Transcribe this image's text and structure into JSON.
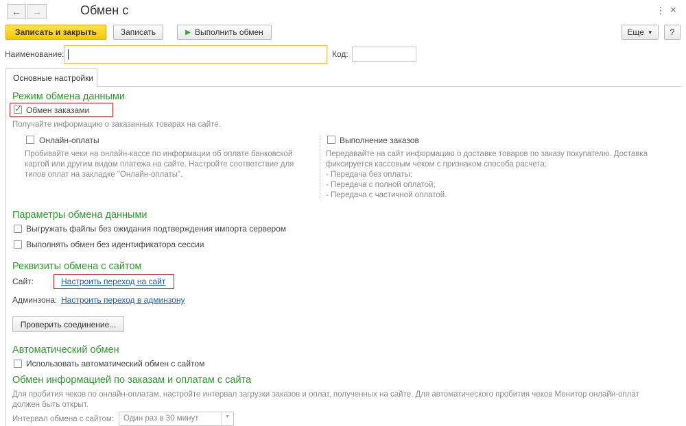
{
  "window": {
    "title": "Обмен с"
  },
  "toolbar": {
    "save_close": "Записать и закрыть",
    "save": "Записать",
    "run_exchange": "Выполнить обмен",
    "more": "Еще",
    "help": "?"
  },
  "form": {
    "name_label": "Наименование:",
    "name_value": "",
    "code_label": "Код:",
    "code_value": ""
  },
  "tabs": [
    {
      "label": "Основные настройки"
    }
  ],
  "mode_section": {
    "title": "Режим обмена данными",
    "orders_exchange": {
      "label": "Обмен заказами",
      "checked": true
    },
    "orders_hint": "Получайте информацию о заказанных товарах на сайте.",
    "online_payments": {
      "label": "Онлайн-оплаты",
      "checked": false,
      "desc": [
        "Пробивайте чеки на онлайн-кассе по информации об оплате банковской",
        "картой или другим видом платежа на сайте. Настройте соответствие для",
        "типов оплат на закладке \"Онлайн-оплаты\"."
      ]
    },
    "order_fulfillment": {
      "label": "Выполнение заказов",
      "checked": false,
      "desc": [
        "Передавайте на сайт информацию о доставке товаров по заказу покупателю. Доставка",
        "фиксируется кассовым чеком с признаком способа расчета:",
        "- Передача без оплаты;",
        "- Передача с полной оплатой;",
        "- Передача с частичной оплатой."
      ]
    }
  },
  "params_section": {
    "title": "Параметры обмена данными",
    "upload_files": {
      "label": "Выгружать файлы без ожидания подтверждения импорта сервером",
      "checked": false
    },
    "no_session": {
      "label": "Выполнять обмен без идентификатора сессии",
      "checked": false
    }
  },
  "site_section": {
    "title": "Реквизиты обмена с сайтом",
    "site_label": "Сайт:",
    "site_link": "Настроить переход на сайт",
    "admin_label": "Админзона:",
    "admin_link": "Настроить переход в админзону",
    "check_button": "Проверить соединение..."
  },
  "auto_section": {
    "title": "Автоматический обмен",
    "use_auto": {
      "label": "Использовать автоматический обмен с сайтом",
      "checked": false
    }
  },
  "orders_info_section": {
    "title": "Обмен информацией по заказам и оплатам с сайта",
    "desc": [
      "Для пробития чеков по онлайн-оплатам, настройте интервал загрузки заказов и оплат, полученных на сайте. Для автоматического пробития чеков Монитор онлайн-оплат",
      "должен быть открыт."
    ],
    "interval_label": "Интервал обмена с сайтом:",
    "interval_value": "Один раз в 30 минут"
  },
  "colors": {
    "accent_green": "#2e9a2e",
    "primary_yellow": "#f5c900",
    "link_blue": "#1e5fb3",
    "highlight_red": "#b8222a"
  }
}
